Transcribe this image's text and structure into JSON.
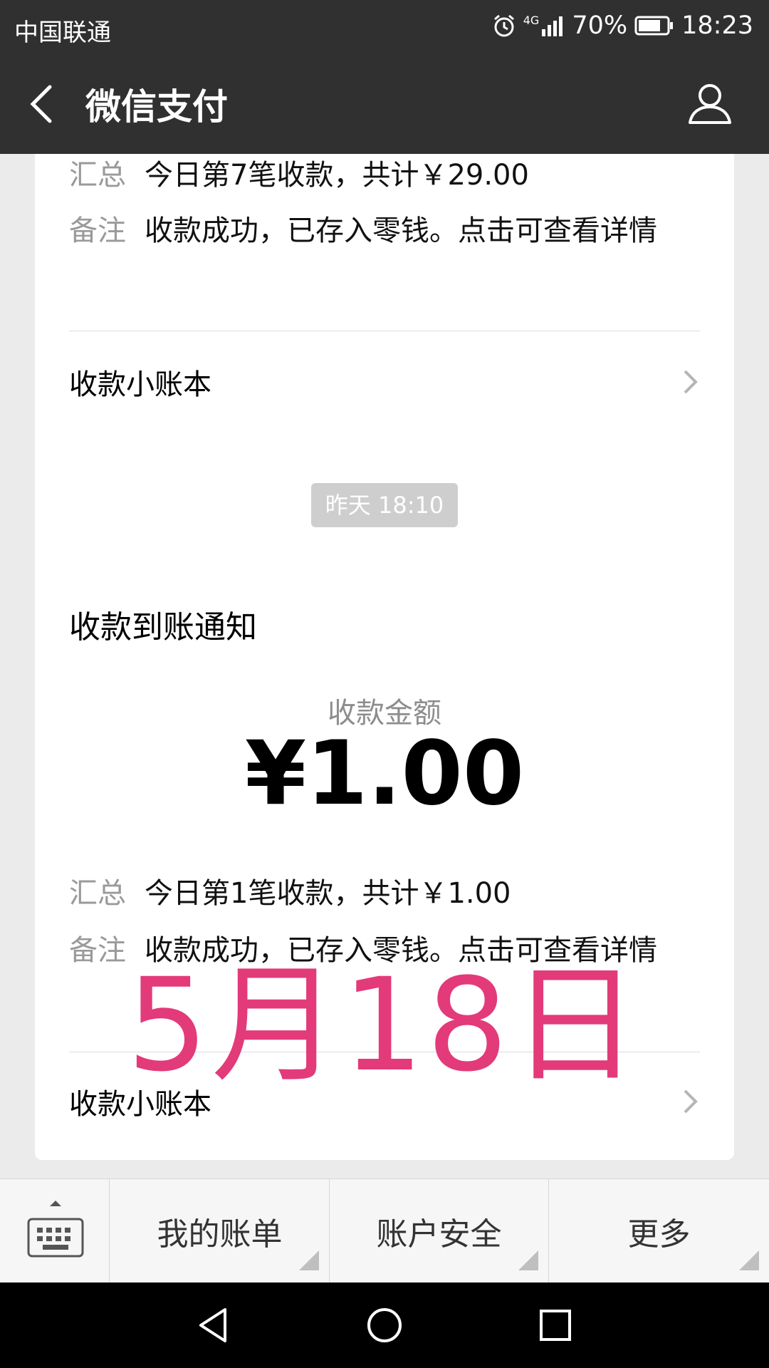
{
  "status_bar": {
    "carrier": "中国联通",
    "network": "4G",
    "battery": "70%",
    "time": "18:23"
  },
  "header": {
    "title": "微信支付"
  },
  "card_top": {
    "summary_label": "汇总",
    "summary_value": "今日第7笔收款，共计￥29.00",
    "note_label": "备注",
    "note_value": "收款成功，已存入零钱。点击可查看详情",
    "ledger_label": "收款小账本"
  },
  "timestamp": "昨天 18:10",
  "card_notice": {
    "title": "收款到账通知",
    "amount_label": "收款金额",
    "amount": "¥1.00",
    "summary_label": "汇总",
    "summary_value": "今日第1笔收款，共计￥1.00",
    "note_label": "备注",
    "note_value": "收款成功，已存入零钱。点击可查看详情",
    "ledger_label": "收款小账本"
  },
  "overlay_text": "5月18日",
  "bottom_menu": {
    "items": [
      {
        "label": "我的账单"
      },
      {
        "label": "账户安全"
      },
      {
        "label": "更多"
      }
    ]
  },
  "colors": {
    "header_bg": "#303030",
    "page_bg": "#ebebeb",
    "overlay_text": "#e33a7a"
  },
  "icons": {
    "back": "chevron-left-icon",
    "profile": "person-icon",
    "chevron": "chevron-right-icon",
    "keyboard": "keyboard-icon",
    "nav_back": "triangle-back-icon",
    "nav_home": "circle-home-icon",
    "nav_recent": "square-recent-icon"
  }
}
